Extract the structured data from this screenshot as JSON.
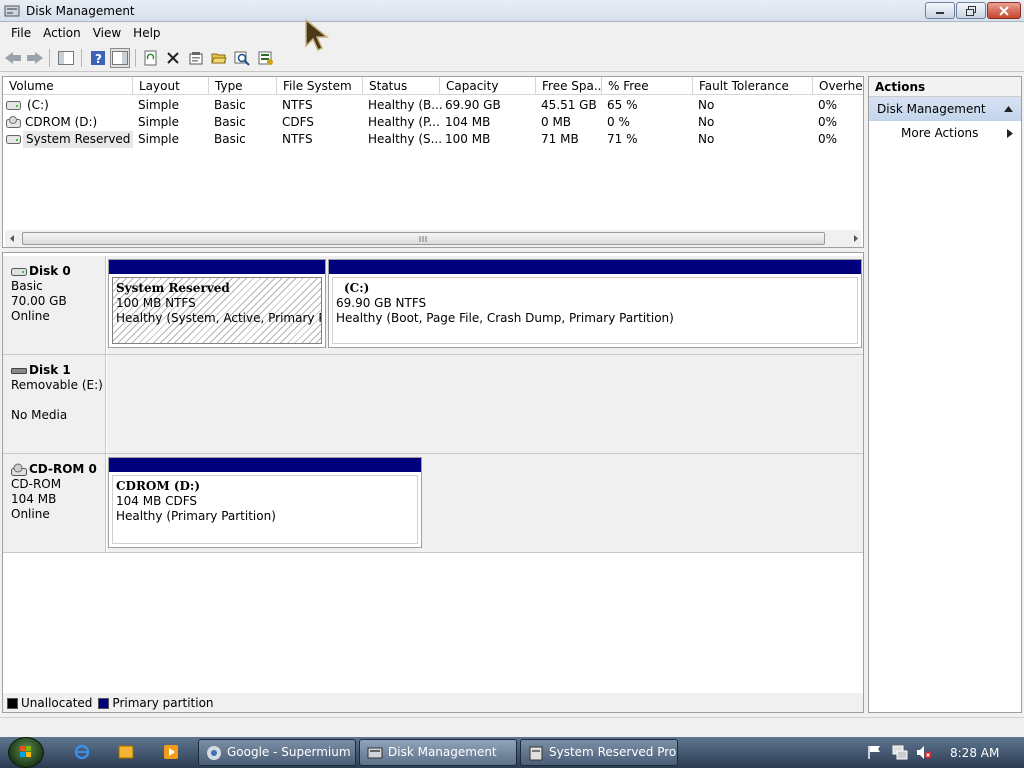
{
  "window": {
    "title": "Disk Management"
  },
  "menu": [
    "File",
    "Action",
    "View",
    "Help"
  ],
  "volume_list": {
    "columns": [
      "Volume",
      "Layout",
      "Type",
      "File System",
      "Status",
      "Capacity",
      "Free Spa...",
      "% Free",
      "Fault Tolerance",
      "Overhea"
    ],
    "rows": [
      [
        "(C:)",
        "Simple",
        "Basic",
        "NTFS",
        "Healthy (B...",
        "69.90 GB",
        "45.51 GB",
        "65 %",
        "No",
        "0%"
      ],
      [
        "CDROM (D:)",
        "Simple",
        "Basic",
        "CDFS",
        "Healthy (P...",
        "104 MB",
        "0 MB",
        "0 %",
        "No",
        "0%"
      ],
      [
        "System Reserved",
        "Simple",
        "Basic",
        "NTFS",
        "Healthy (S...",
        "100 MB",
        "71 MB",
        "71 %",
        "No",
        "0%"
      ]
    ]
  },
  "disks": [
    {
      "name": "Disk 0",
      "line1": "Basic",
      "line2": "70.00 GB",
      "line3": "Online",
      "partitions": [
        {
          "name": "System Reserved",
          "size": "100 MB NTFS",
          "status": "Healthy (System, Active, Primary Partit"
        },
        {
          "name": "(C:)",
          "size": "69.90 GB NTFS",
          "status": "Healthy (Boot, Page File, Crash Dump, Primary Partition)"
        }
      ]
    },
    {
      "name": "Disk 1",
      "line1": "Removable (E:)",
      "line2": "",
      "line3": "No Media",
      "partitions": []
    },
    {
      "name": "CD-ROM 0",
      "line1": "CD-ROM",
      "line2": "104 MB",
      "line3": "Online",
      "partitions": [
        {
          "name": "CDROM  (D:)",
          "size": "104 MB CDFS",
          "status": "Healthy (Primary Partition)"
        }
      ]
    }
  ],
  "legend": [
    {
      "label": "Unallocated",
      "color": "#000000"
    },
    {
      "label": "Primary partition",
      "color": "#00007d"
    }
  ],
  "actions": {
    "header": "Actions",
    "section": "Disk Management",
    "items": [
      "More Actions"
    ]
  },
  "taskbar": {
    "buttons": [
      "Google - Supermium",
      "Disk Management",
      "System Reserved Pro..."
    ],
    "clock": "8:28 AM"
  },
  "colors": {
    "primary_partition": "#00007d",
    "selection": "#c3d4eb"
  }
}
